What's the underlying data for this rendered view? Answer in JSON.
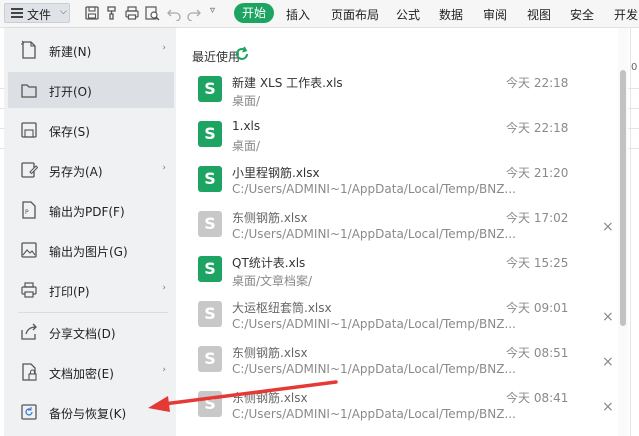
{
  "toolbar": {
    "file_label": "文件",
    "tabs": [
      {
        "label": "开始"
      },
      {
        "label": "插入"
      },
      {
        "label": "页面布局"
      },
      {
        "label": "公式"
      },
      {
        "label": "数据"
      },
      {
        "label": "审阅"
      },
      {
        "label": "视图"
      },
      {
        "label": "安全"
      },
      {
        "label": "开发"
      }
    ],
    "accent": "#1ea462"
  },
  "sheet": {
    "partial_header": "0"
  },
  "menu": {
    "items": [
      {
        "label": "新建(N)",
        "icon": "new-file-icon",
        "submenu": true
      },
      {
        "label": "打开(O)",
        "icon": "folder-icon",
        "submenu": false,
        "highlighted": true
      },
      {
        "label": "保存(S)",
        "icon": "save-icon",
        "submenu": false
      },
      {
        "label": "另存为(A)",
        "icon": "save-as-icon",
        "submenu": true
      },
      {
        "label": "输出为PDF(F)",
        "icon": "pdf-export-icon",
        "submenu": false
      },
      {
        "label": "输出为图片(G)",
        "icon": "image-export-icon",
        "submenu": false
      },
      {
        "label": "打印(P)",
        "icon": "print-icon",
        "submenu": true
      },
      {
        "label": "分享文档(D)",
        "icon": "share-icon",
        "submenu": false
      },
      {
        "label": "文档加密(E)",
        "icon": "encrypt-icon",
        "submenu": true
      },
      {
        "label": "备份与恢复(K)",
        "icon": "backup-icon",
        "submenu": true
      }
    ]
  },
  "recent": {
    "title": "最近使用",
    "files": [
      {
        "name": "新建 XLS 工作表.xls",
        "path": "桌面/",
        "time": "今天 22:18",
        "available": true,
        "closable": false
      },
      {
        "name": "1.xls",
        "path": "桌面/",
        "time": "今天 22:18",
        "available": true,
        "closable": false
      },
      {
        "name": "小里程钢筋.xlsx",
        "path": "C:/Users/ADMINI~1/AppData/Local/Temp/BNZ...",
        "time": "今天 21:20",
        "available": true,
        "closable": false
      },
      {
        "name": "东侧钢筋.xlsx",
        "path": "C:/Users/ADMINI~1/AppData/Local/Temp/BNZ...",
        "time": "今天 17:02",
        "available": false,
        "closable": true
      },
      {
        "name": "QT统计表.xls",
        "path": "桌面/文章档案/",
        "time": "今天 15:25",
        "available": true,
        "closable": false
      },
      {
        "name": "大运枢纽套筒.xlsx",
        "path": "C:/Users/ADMINI~1/AppData/Local/Temp/BNZ...",
        "time": "今天 09:01",
        "available": false,
        "closable": true
      },
      {
        "name": "东侧钢筋.xlsx",
        "path": "C:/Users/ADMINI~1/AppData/Local/Temp/BNZ...",
        "time": "今天 08:51",
        "available": false,
        "closable": true
      },
      {
        "name": "东侧钢筋.xlsx",
        "path": "C:/Users/ADMINI~1/AppData/Local/Temp/BNZ...",
        "time": "今天 08:41",
        "available": false,
        "closable": true
      }
    ],
    "icon_letter": "S",
    "close_glyph": "×",
    "color_available": "#1ea462",
    "color_unavailable": "#c8c8c8"
  },
  "annotation": {
    "arrow_color": "#e53935"
  }
}
